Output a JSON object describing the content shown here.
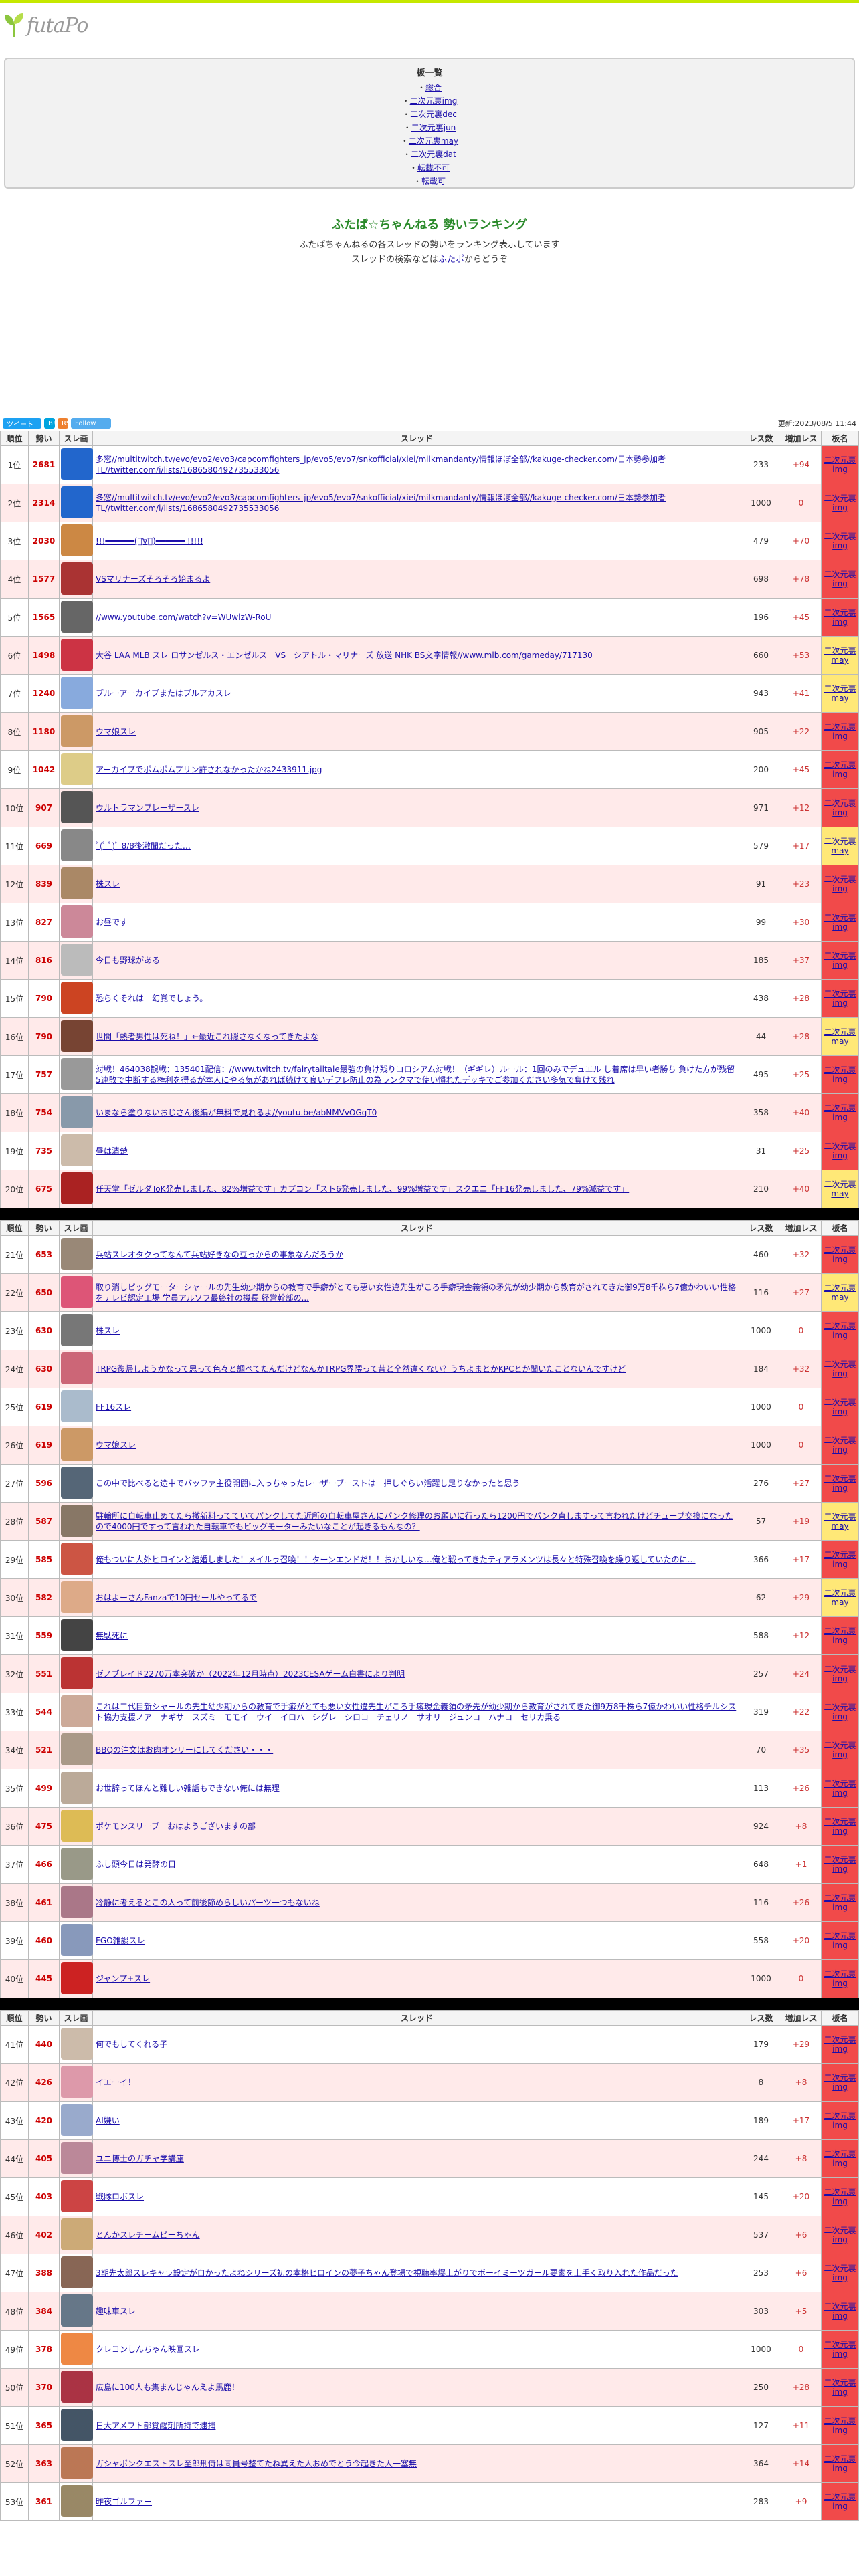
{
  "logo": {
    "text": "futaPo"
  },
  "boards": {
    "title": "板一覧",
    "items": [
      "総合",
      "二次元裏img",
      "二次元裏dec",
      "二次元裏jun",
      "二次元裏may",
      "二次元裏dat",
      "転載不可",
      "転載可"
    ]
  },
  "intro": {
    "title": "ふたば☆ちゃんねる 勢いランキング",
    "line1": "ふたばちゃんねるの各スレッドの勢いをランキング表示しています",
    "line2_pre": "スレッドの検索などは",
    "line2_link": "ふたポ",
    "line2_post": "からどうぞ"
  },
  "social": {
    "tweet": "ツイート",
    "hatena": "B!",
    "rss": "RSS",
    "follow": "Follow",
    "updated": "更新:2023/08/5 11:44"
  },
  "headers": {
    "rank": "順位",
    "ikioi": "勢い",
    "thumb": "スレ画",
    "thread": "スレッド",
    "res": "レス数",
    "inc": "増加レス",
    "board": "板名"
  },
  "rows": [
    {
      "rank": "1位",
      "ikioi": "2681",
      "title": "多窓//multitwitch.tv/evo/evo2/evo3/capcomfighters_jp/evo5/evo7/snkofficial/xiei/milkmandanty/情報ほぼ全部//kakuge-checker.com/日本勢参加者TL//twitter.com/i/lists/1686580492735533056",
      "res": "233",
      "inc": "+94",
      "board": "二次元裏img",
      "c": "#2266cc"
    },
    {
      "rank": "2位",
      "ikioi": "2314",
      "title": "多窓//multitwitch.tv/evo/evo2/evo3/capcomfighters_jp/evo5/evo7/snkofficial/xiei/milkmandanty/情報ほぼ全部//kakuge-checker.com/日本勢参加者TL//twitter.com/i/lists/1686580492735533056",
      "res": "1000",
      "inc": "0",
      "board": "二次元裏img",
      "c": "#2266cc"
    },
    {
      "rank": "3位",
      "ikioi": "2030",
      "title": "!!!━━━━━━(ﾟ∀ﾟ)━━━━━━ !!!!!",
      "res": "479",
      "inc": "+70",
      "board": "二次元裏img",
      "c": "#cc8844"
    },
    {
      "rank": "4位",
      "ikioi": "1577",
      "title": "VSマリナーズそろそろ始まるよ",
      "res": "698",
      "inc": "+78",
      "board": "二次元裏img",
      "c": "#aa3333"
    },
    {
      "rank": "5位",
      "ikioi": "1565",
      "title": "//www.youtube.com/watch?v=WUwlzW-RoU",
      "res": "196",
      "inc": "+45",
      "board": "二次元裏img",
      "c": "#666666"
    },
    {
      "rank": "6位",
      "ikioi": "1498",
      "title": "大谷 LAA MLB スレ ロサンゼルス・エンゼルス　VS　シアトル・マリナーズ 放送 NHK BS文字情報//www.mlb.com/gameday/717130",
      "res": "660",
      "inc": "+53",
      "board": "二次元裏may",
      "c": "#cc3344"
    },
    {
      "rank": "7位",
      "ikioi": "1240",
      "title": "ブルーアーカイブまたはブルアカスレ",
      "res": "943",
      "inc": "+41",
      "board": "二次元裏may",
      "c": "#88aadd"
    },
    {
      "rank": "8位",
      "ikioi": "1180",
      "title": "ウマ娘スレ",
      "res": "905",
      "inc": "+22",
      "board": "二次元裏img",
      "c": "#cc9966"
    },
    {
      "rank": "9位",
      "ikioi": "1042",
      "title": "アーカイブでポムポムプリン許されなかったかね2433911.jpg",
      "res": "200",
      "inc": "+45",
      "board": "二次元裏img",
      "c": "#ddcc88"
    },
    {
      "rank": "10位",
      "ikioi": "907",
      "title": "ウルトラマンブレーザースレ",
      "res": "971",
      "inc": "+12",
      "board": "二次元裏img",
      "c": "#555555"
    },
    {
      "rank": "11位",
      "ikioi": "669",
      "title": "ﾟ(ﾟ ﾟ)ﾟ 8/8後激聞だった…",
      "res": "579",
      "inc": "+17",
      "board": "二次元裏may",
      "c": "#888888"
    },
    {
      "rank": "12位",
      "ikioi": "839",
      "title": "株スレ",
      "res": "91",
      "inc": "+23",
      "board": "二次元裏img",
      "c": "#aa8866"
    },
    {
      "rank": "13位",
      "ikioi": "827",
      "title": "お昼です",
      "res": "99",
      "inc": "+30",
      "board": "二次元裏img",
      "c": "#cc8899"
    },
    {
      "rank": "14位",
      "ikioi": "816",
      "title": "今日も野球がある",
      "res": "185",
      "inc": "+37",
      "board": "二次元裏img",
      "c": "#bbbbbb"
    },
    {
      "rank": "15位",
      "ikioi": "790",
      "title": "恐らくそれは　幻覚でしょう。",
      "res": "438",
      "inc": "+28",
      "board": "二次元裏img",
      "c": "#cc4422"
    },
    {
      "rank": "16位",
      "ikioi": "790",
      "title": "世間「熱者男性は死ね！」←最近これ隠さなくなってきたよな",
      "res": "44",
      "inc": "+28",
      "board": "二次元裏may",
      "c": "#774433"
    },
    {
      "rank": "17位",
      "ikioi": "757",
      "title": "対戦！464038観戦：135401配信：//www.twitch.tv/fairytailtale最強の負け残りコロシアム対戦！（ギギレ）ルール：1回のみでデュエル し着席は早い者勝ち 負けた方が残留 5連敗で中断する権利を得るが本人にやる気があれば続けて良いデフレ防止の為ランクマで使い慣れたデッキでご参加ください多気で負けて残れ",
      "res": "495",
      "inc": "+25",
      "board": "二次元裏img",
      "c": "#999999"
    },
    {
      "rank": "18位",
      "ikioi": "754",
      "title": "いまなら塗りないおじさん後編が無料で見れるよ//youtu.be/abNMVvOGqT0",
      "res": "358",
      "inc": "+40",
      "board": "二次元裏img",
      "c": "#8899aa"
    },
    {
      "rank": "19位",
      "ikioi": "735",
      "title": "昼は清楚",
      "res": "31",
      "inc": "+25",
      "board": "二次元裏img",
      "c": "#ccbbaa"
    },
    {
      "rank": "20位",
      "ikioi": "675",
      "title": "任天堂「ゼルダToK発売しました、82%増益です」カプコン「スト6発売しました、99%増益です」スクエニ「FF16発売しました、79%減益です」",
      "res": "210",
      "inc": "+40",
      "board": "二次元裏may",
      "c": "#aa2222"
    },
    {
      "rank": "21位",
      "ikioi": "653",
      "title": "兵站スレオタクってなんて兵站好きなの豆っからの事象なんだろうか",
      "res": "460",
      "inc": "+32",
      "board": "二次元裏img",
      "c": "#998877"
    },
    {
      "rank": "22位",
      "ikioi": "650",
      "title": "取り消しビッグモーターシャールの先生幼少期からの教育で手癖がとても悪い女性違先生がころ手癖現金義領の矛先が幼少期から教育がされてきた御9万8千株ら7億かわいい性格をテレビ認定工場 学員アルソフ最終社の機長 経営幹部の...",
      "res": "116",
      "inc": "+27",
      "board": "二次元裏may",
      "c": "#dd5577"
    },
    {
      "rank": "23位",
      "ikioi": "630",
      "title": "株スレ",
      "res": "1000",
      "inc": "0",
      "board": "二次元裏img",
      "c": "#777777"
    },
    {
      "rank": "24位",
      "ikioi": "630",
      "title": "TRPG復帰しようかなって思って色々と調べてたんだけどなんかTRPG界隈って昔と全然違くない？うちよまとかKPCとか聞いたことないんですけど",
      "res": "184",
      "inc": "+32",
      "board": "二次元裏img",
      "c": "#cc6677"
    },
    {
      "rank": "25位",
      "ikioi": "619",
      "title": "FF16スレ",
      "res": "1000",
      "inc": "0",
      "board": "二次元裏img",
      "c": "#aabbcc"
    },
    {
      "rank": "26位",
      "ikioi": "619",
      "title": "ウマ娘スレ",
      "res": "1000",
      "inc": "0",
      "board": "二次元裏img",
      "c": "#cc9966"
    },
    {
      "rank": "27位",
      "ikioi": "596",
      "title": "この中で比べると途中でバッファ主役開闘に入っちゃったレーザーブーストは一押しぐらい活躍し足りなかったと思う",
      "res": "276",
      "inc": "+27",
      "board": "二次元裏img",
      "c": "#556677"
    },
    {
      "rank": "28位",
      "ikioi": "587",
      "title": "駐輪所に自転車止めてたら撤新料ってていてパンクしてた近所の自転車屋さんにパンク修理のお願いに行ったら1200円でパンク直しますって言われたけどチューブ交換になったので4000円ですって言われた自転車でもビッグモーターみたいなことが起きるもんなの？",
      "res": "57",
      "inc": "+19",
      "board": "二次元裏may",
      "c": "#887766"
    },
    {
      "rank": "29位",
      "ikioi": "585",
      "title": "俺もついに人外ヒロインと結婚しました！メイルゥ召喚！！ターンエンドだ！！おかしいな…俺と戦ってきたティアラメンツは長々と特殊召喚を繰り返していたのに…",
      "res": "366",
      "inc": "+17",
      "board": "二次元裏img",
      "c": "#cc5544"
    },
    {
      "rank": "30位",
      "ikioi": "582",
      "title": "おはよーさんFanzaで10円セールやってるで",
      "res": "62",
      "inc": "+29",
      "board": "二次元裏may",
      "c": "#ddaa88"
    },
    {
      "rank": "31位",
      "ikioi": "559",
      "title": "無駄死に",
      "res": "588",
      "inc": "+12",
      "board": "二次元裏img",
      "c": "#444444"
    },
    {
      "rank": "32位",
      "ikioi": "551",
      "title": "ゼノブレイド2270万本突破か（2022年12月時点）2023CESAゲーム白書により判明",
      "res": "257",
      "inc": "+24",
      "board": "二次元裏img",
      "c": "#bb3333"
    },
    {
      "rank": "33位",
      "ikioi": "544",
      "title": "これは二代目新シャールの先生幼少期からの教育で手癖がとても悪い女性違先生がころ手癖現金義領の矛先が幼少期から教育がされてきた御9万8千株ら7億かわいい性格チルシスト協力支援ノア　ナギサ　スズミ　モモイ　ウイ　イロハ　シグレ　シロコ　チェリノ　サオリ　ジュンコ　ハナコ　セリカ乗る",
      "res": "319",
      "inc": "+22",
      "board": "二次元裏img",
      "c": "#ccaa99"
    },
    {
      "rank": "34位",
      "ikioi": "521",
      "title": "BBQの注文はお肉オンリーにしてください・・・",
      "res": "70",
      "inc": "+35",
      "board": "二次元裏img",
      "c": "#aa9988"
    },
    {
      "rank": "35位",
      "ikioi": "499",
      "title": "お世辞ってほんと難しい雑話もできない俺には無理",
      "res": "113",
      "inc": "+26",
      "board": "二次元裏img",
      "c": "#bbaa99"
    },
    {
      "rank": "36位",
      "ikioi": "475",
      "title": "ポケモンスリープ　おはようございますの部",
      "res": "924",
      "inc": "+8",
      "board": "二次元裏img",
      "c": "#ddbb55"
    },
    {
      "rank": "37位",
      "ikioi": "466",
      "title": "ふし頭今日は発酵の日",
      "res": "648",
      "inc": "+1",
      "board": "二次元裏img",
      "c": "#999988"
    },
    {
      "rank": "38位",
      "ikioi": "461",
      "title": "冷静に考えるとこの人って前後節めらしいパーツ一つもないね",
      "res": "116",
      "inc": "+26",
      "board": "二次元裏img",
      "c": "#aa7788"
    },
    {
      "rank": "39位",
      "ikioi": "460",
      "title": "FGO雑談スレ",
      "res": "558",
      "inc": "+20",
      "board": "二次元裏img",
      "c": "#8899bb"
    },
    {
      "rank": "40位",
      "ikioi": "445",
      "title": "ジャンプ+スレ",
      "res": "1000",
      "inc": "0",
      "board": "二次元裏img",
      "c": "#cc2222"
    },
    {
      "rank": "41位",
      "ikioi": "440",
      "title": "何でもしてくれる子",
      "res": "179",
      "inc": "+29",
      "board": "二次元裏img",
      "c": "#ccbbaa"
    },
    {
      "rank": "42位",
      "ikioi": "426",
      "title": "イエーイ！",
      "res": "8",
      "inc": "+8",
      "board": "二次元裏img",
      "c": "#dd99aa"
    },
    {
      "rank": "43位",
      "ikioi": "420",
      "title": "AI嫌い",
      "res": "189",
      "inc": "+17",
      "board": "二次元裏img",
      "c": "#99aacc"
    },
    {
      "rank": "44位",
      "ikioi": "405",
      "title": "ユニ博士のガチャ学講座",
      "res": "244",
      "inc": "+8",
      "board": "二次元裏img",
      "c": "#bb8899"
    },
    {
      "rank": "45位",
      "ikioi": "403",
      "title": "戦隊ロボスレ",
      "res": "145",
      "inc": "+20",
      "board": "二次元裏img",
      "c": "#cc4444"
    },
    {
      "rank": "46位",
      "ikioi": "402",
      "title": "とんかスレチームピーちゃん",
      "res": "537",
      "inc": "+6",
      "board": "二次元裏img",
      "c": "#ccaa77"
    },
    {
      "rank": "47位",
      "ikioi": "388",
      "title": "3期先太郎スレキャラ設定が自かったよねシリーズ初の本格ヒロインの夢子ちゃん登場で視聴率爆上がりでボーイミーツガール要素を上手く取り入れた作品だった",
      "res": "253",
      "inc": "+6",
      "board": "二次元裏img",
      "c": "#886655"
    },
    {
      "rank": "48位",
      "ikioi": "384",
      "title": "趣味車スレ",
      "res": "303",
      "inc": "+5",
      "board": "二次元裏img",
      "c": "#667788"
    },
    {
      "rank": "49位",
      "ikioi": "378",
      "title": "クレヨンしんちゃん映画スレ",
      "res": "1000",
      "inc": "0",
      "board": "二次元裏img",
      "c": "#ee8844"
    },
    {
      "rank": "50位",
      "ikioi": "370",
      "title": "広島に100人も集まんじゃんえよ馬鹿！",
      "res": "250",
      "inc": "+28",
      "board": "二次元裏img",
      "c": "#aa3344"
    },
    {
      "rank": "51位",
      "ikioi": "365",
      "title": "日大アメフト部覚醒剤所持で逮捕",
      "res": "127",
      "inc": "+11",
      "board": "二次元裏img",
      "c": "#445566"
    },
    {
      "rank": "52位",
      "ikioi": "363",
      "title": "ガシャポンクエストスレ至郎刑侍は同員号整てたね異えた人おめでとう今起きた人一塞無",
      "res": "364",
      "inc": "+14",
      "board": "二次元裏img",
      "c": "#bb7755"
    },
    {
      "rank": "53位",
      "ikioi": "361",
      "title": "昨夜ゴルファー",
      "res": "283",
      "inc": "+9",
      "board": "二次元裏img",
      "c": "#998866"
    }
  ]
}
